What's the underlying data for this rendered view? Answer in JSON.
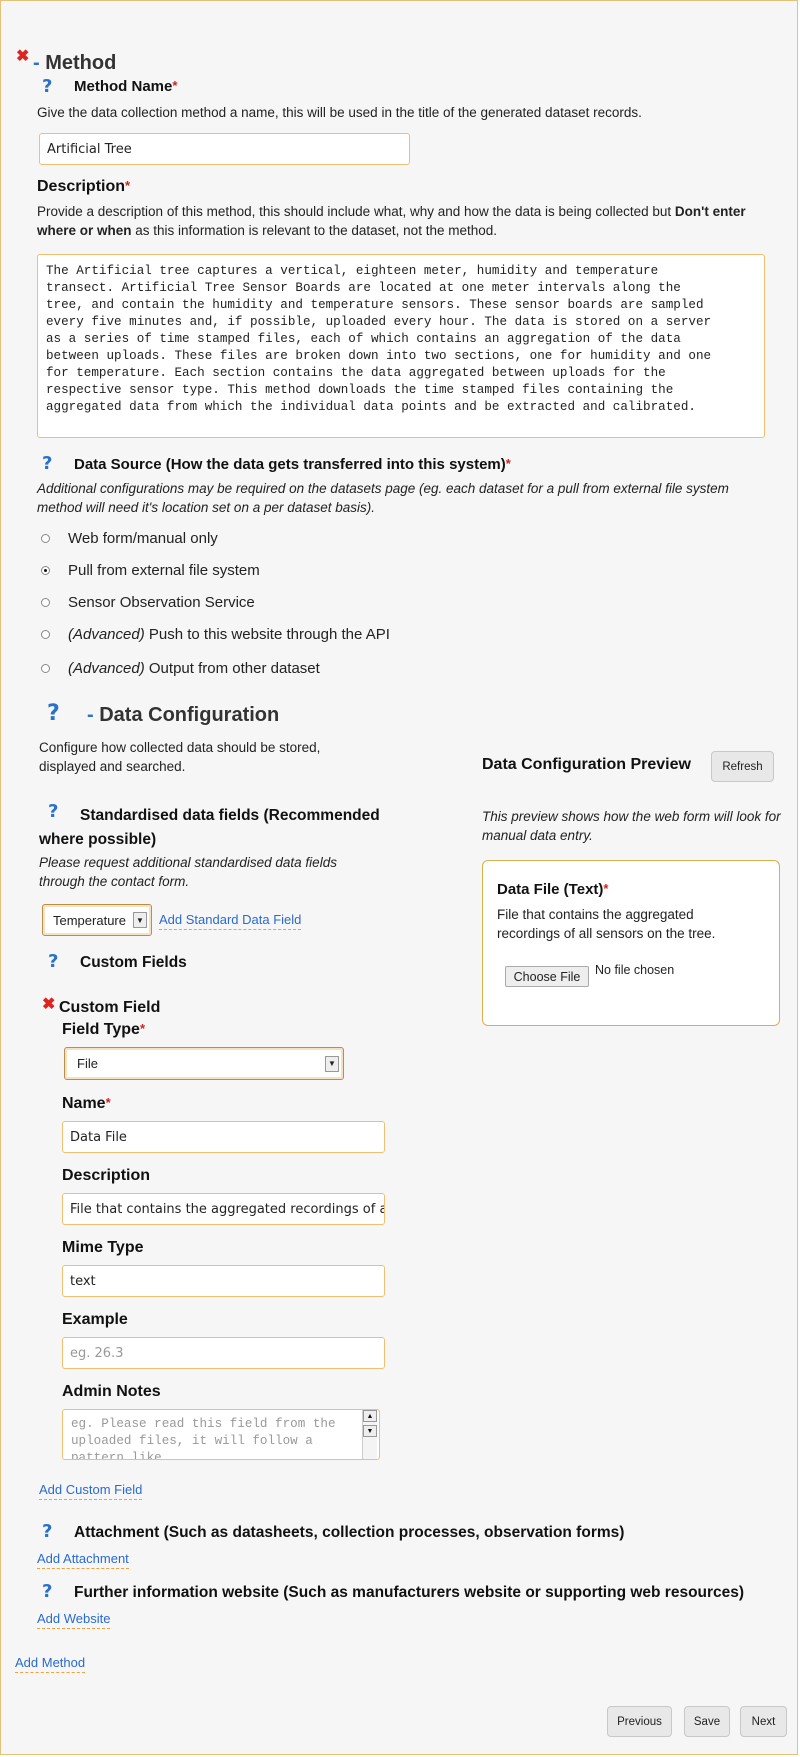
{
  "method": {
    "section_title": "- Method",
    "name_label": "Method Name",
    "name_help": "Give the data collection method a name, this will be used in the title of the generated dataset records.",
    "name_value": "Artificial Tree",
    "description_label": "Description",
    "description_help_part1": "Provide a description of this method, this should include what, why and how the data is being collected but ",
    "description_help_bold": "Don't enter where or when",
    "description_help_part2": " as this information is relevant to the dataset, not the method.",
    "description_value": "The Artificial tree captures a vertical, eighteen meter, humidity and temperature\ntransect. Artificial Tree Sensor Boards are located at one meter intervals along the\ntree, and contain the humidity and temperature sensors. These sensor boards are sampled\nevery five minutes and, if possible, uploaded every hour. The data is stored on a server\nas a series of time stamped files, each of which contains an aggregation of the data\nbetween uploads. These files are broken down into two sections, one for humidity and one\nfor temperature. Each section contains the data aggregated between uploads for the\nrespective sensor type. This method downloads the time stamped files containing the\naggregated data from which the individual data points and be extracted and calibrated."
  },
  "data_source": {
    "label": "Data Source (How the data gets transferred into this system)",
    "help": "Additional configurations may be required on the datasets page (eg. each dataset for a pull from external file system method will need it's location set on a per dataset basis).",
    "options": [
      {
        "prefix": "",
        "label": "Web form/manual only",
        "selected": false
      },
      {
        "prefix": "",
        "label": "Pull from external file system",
        "selected": true
      },
      {
        "prefix": "",
        "label": "Sensor Observation Service",
        "selected": false
      },
      {
        "prefix": "(Advanced)",
        "label": " Push to this website through the API",
        "selected": false
      },
      {
        "prefix": "(Advanced)",
        "label": " Output from other dataset",
        "selected": false
      }
    ]
  },
  "data_config": {
    "section_title": "- Data Configuration",
    "help": "Configure how collected data should be stored, displayed and searched.",
    "standard_label": "Standardised data fields (Recommended where possible)",
    "standard_help": "Please request additional standardised data fields through the contact form.",
    "standard_select": "Temperature",
    "add_standard": "Add Standard Data Field",
    "custom_label": "Custom Fields",
    "custom_field_title": "Custom Field",
    "field_type_label": "Field Type",
    "field_type_value": "File",
    "name_label": "Name",
    "name_value": "Data File",
    "description_label": "Description",
    "description_value": "File that contains the aggregated recordings of all sensors on the tree.",
    "mime_label": "Mime Type",
    "mime_value": "text",
    "example_label": "Example",
    "example_placeholder": "eg. 26.3",
    "notes_label": "Admin Notes",
    "notes_placeholder": "eg. Please read this field from the uploaded files, it will follow a pattern like...",
    "add_custom": "Add Custom Field"
  },
  "preview": {
    "title": "Data Configuration Preview",
    "refresh": "Refresh",
    "help": "This preview shows how the web form will look for manual data entry.",
    "field_label": "Data File (Text)",
    "field_help": "File that contains the aggregated recordings of all sensors on the tree.",
    "choose_button": "Choose File",
    "no_file": "No file chosen"
  },
  "attachment": {
    "label": "Attachment (Such as datasheets, collection processes, observation forms)",
    "add": "Add Attachment"
  },
  "website": {
    "label": "Further information website (Such as manufacturers website or supporting web resources)",
    "add": "Add Website"
  },
  "add_method": "Add Method",
  "footer": {
    "previous": "Previous",
    "save": "Save",
    "next": "Next"
  }
}
